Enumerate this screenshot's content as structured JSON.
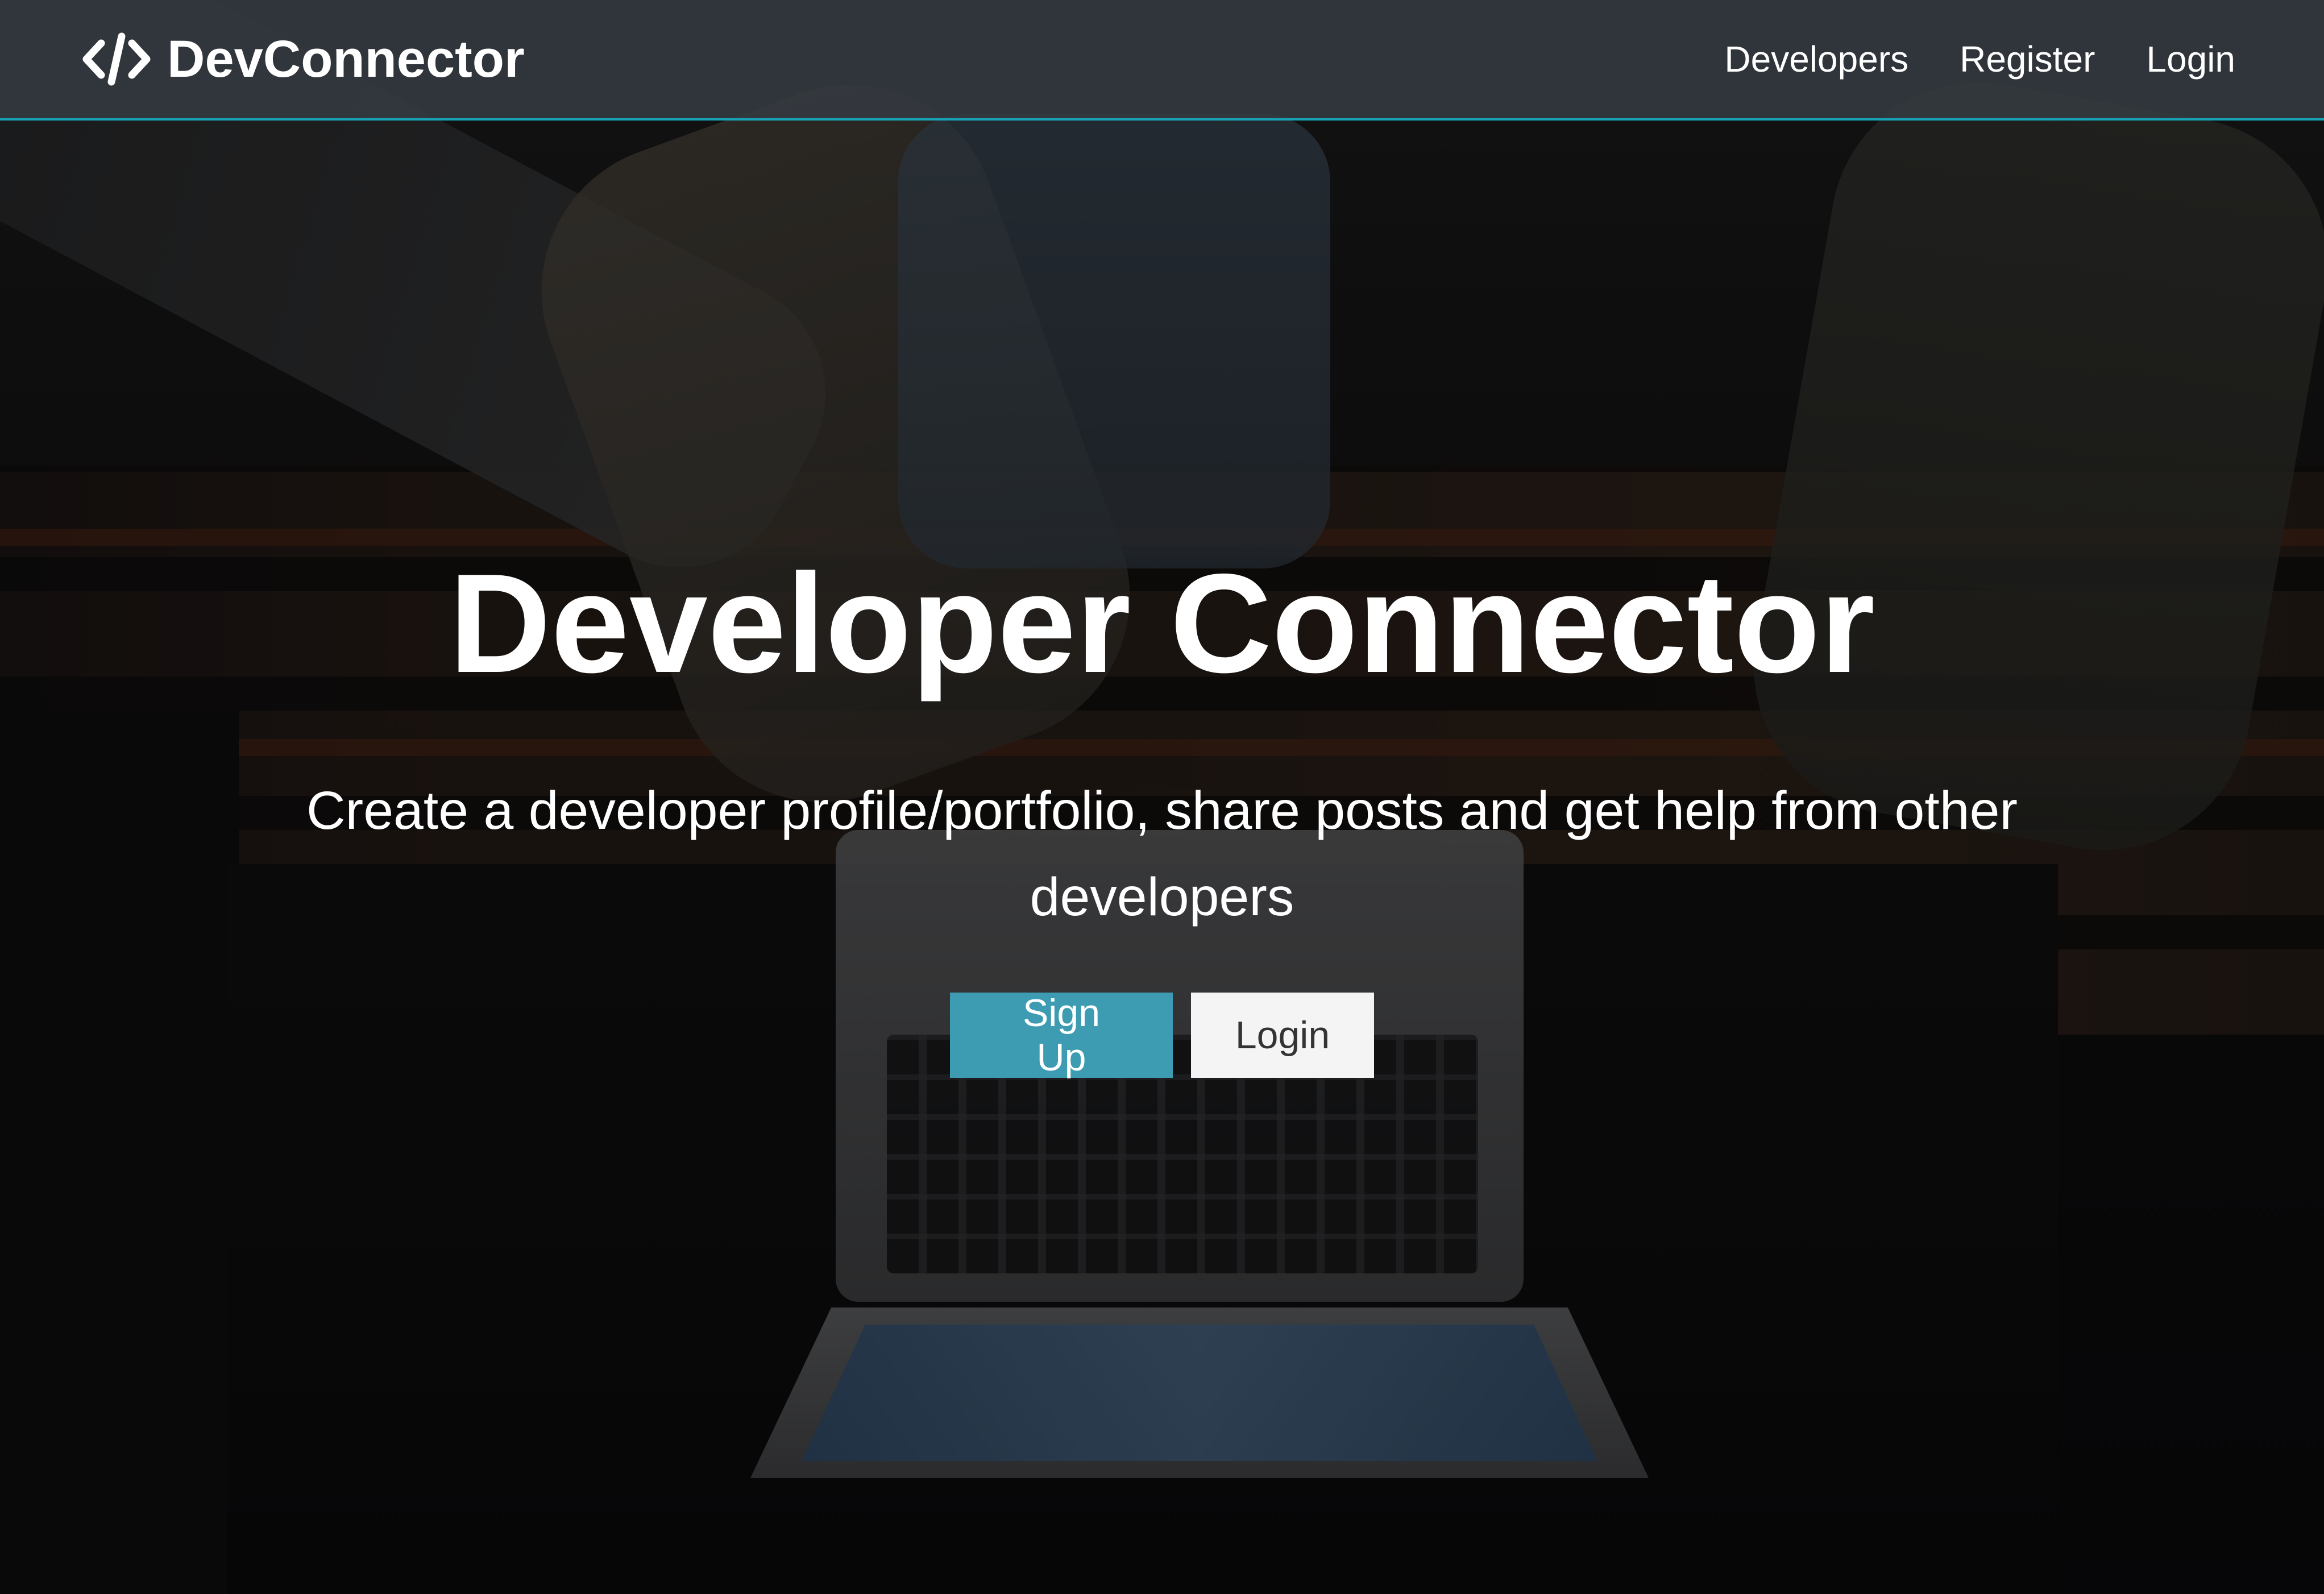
{
  "navbar": {
    "brand_icon": "code-icon",
    "brand_name": "DevConnector",
    "links": [
      {
        "label": "Developers"
      },
      {
        "label": "Register"
      },
      {
        "label": "Login"
      }
    ]
  },
  "hero": {
    "title": "Developer Connector",
    "lead": "Create a developer profile/portfolio, share posts and get help from other developers",
    "buttons": {
      "signup_label": "Sign Up",
      "login_label": "Login"
    }
  },
  "colors": {
    "primary": "#17a2b8",
    "navbar_bg": "#343a40",
    "light": "#f4f4f4",
    "text_dark": "#333333"
  }
}
